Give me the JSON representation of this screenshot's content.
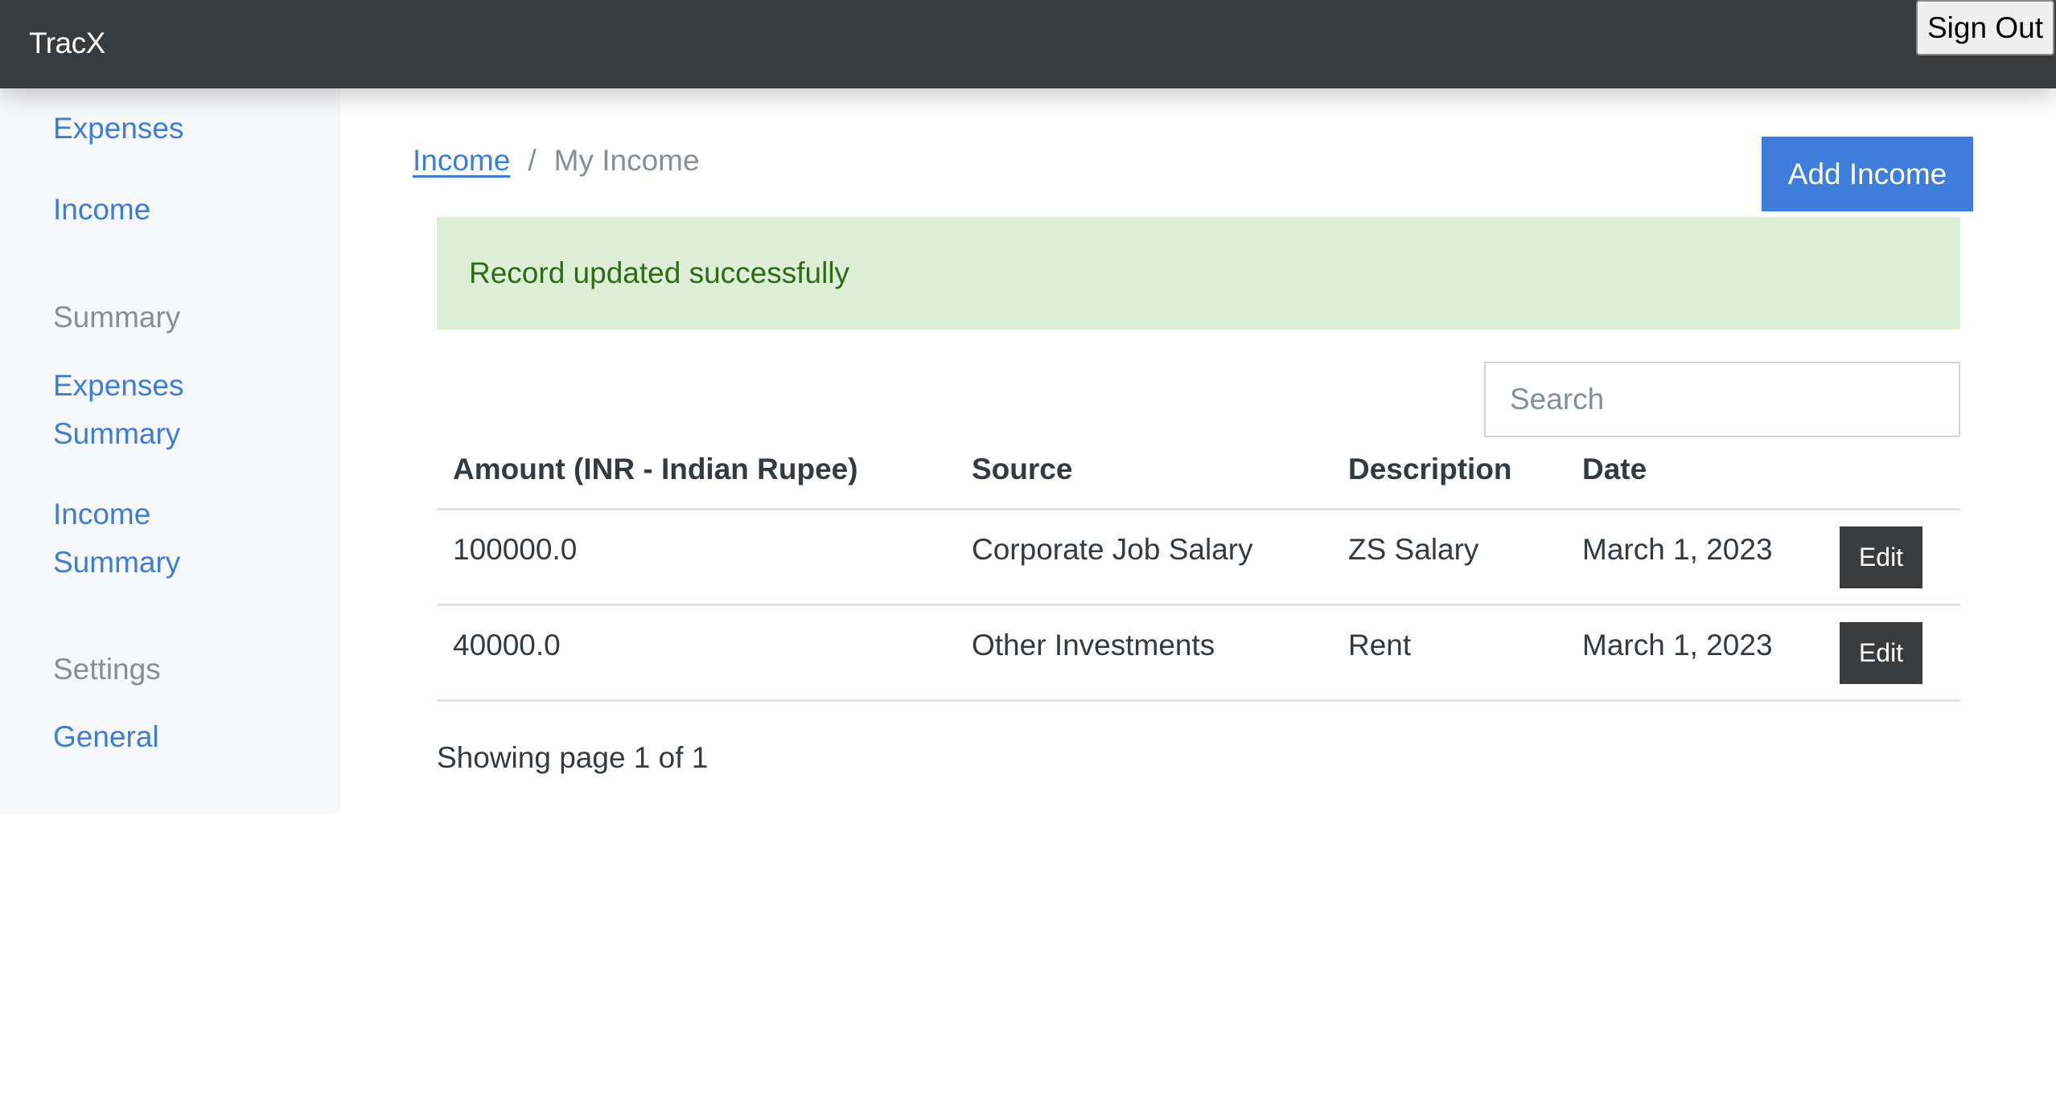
{
  "navbar": {
    "brand": "TracX",
    "sign_out_label": "Sign Out"
  },
  "sidebar": {
    "items": [
      {
        "type": "link",
        "label": "Expenses"
      },
      {
        "type": "link",
        "label": "Income"
      },
      {
        "type": "heading",
        "label": "Summary"
      },
      {
        "type": "link",
        "label": "Expenses Summary",
        "lines": [
          "Expenses",
          "Summary"
        ]
      },
      {
        "type": "link",
        "label": "Income Summary",
        "lines": [
          "Income",
          "Summary"
        ]
      },
      {
        "type": "heading",
        "label": "Settings"
      },
      {
        "type": "link",
        "label": "General"
      }
    ]
  },
  "breadcrumb": {
    "parent": "Income",
    "separator": "/",
    "current": "My Income"
  },
  "actions": {
    "add_income_label": "Add Income"
  },
  "alert": {
    "type": "success",
    "message": "Record updated successfully"
  },
  "search": {
    "placeholder": "Search",
    "value": ""
  },
  "table": {
    "columns": [
      "Amount (INR - Indian Rupee)",
      "Source",
      "Description",
      "Date"
    ],
    "rows": [
      {
        "amount": "100000.0",
        "source": "Corporate Job Salary",
        "description": "ZS Salary",
        "date": "March 1, 2023",
        "action": "Edit"
      },
      {
        "amount": "40000.0",
        "source": "Other Investments",
        "description": "Rent",
        "date": "March 1, 2023",
        "action": "Edit"
      }
    ]
  },
  "pagination": {
    "text": "Showing page 1 of 1",
    "current_page": 1,
    "total_pages": 1
  },
  "colors": {
    "navbar_bg": "#3a3b3d",
    "link": "#3b7ddd",
    "primary_button": "#3f7ddb",
    "alert_bg": "#ddefd6",
    "alert_text": "#2e6b17",
    "sidebar_bg": "#f7f8fa"
  }
}
